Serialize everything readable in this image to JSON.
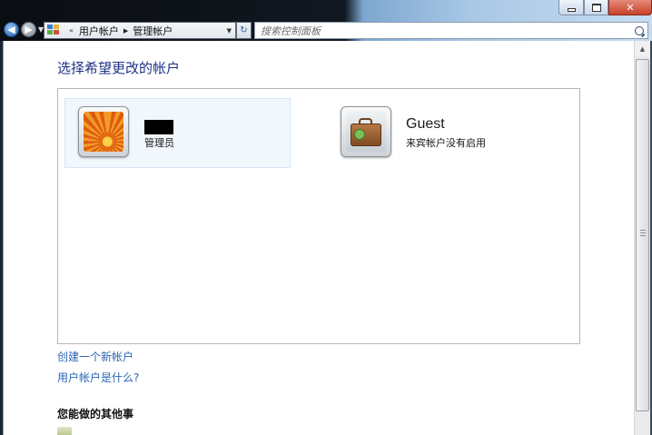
{
  "address_bar": {
    "overflow_marker": "«",
    "crumbs": [
      "用户帐户",
      "管理帐户"
    ]
  },
  "search": {
    "placeholder": "搜索控制面板"
  },
  "main": {
    "heading": "选择希望更改的帐户",
    "accounts": [
      {
        "name": "",
        "name_redacted": true,
        "role": "管理员",
        "selected": true,
        "picture": "orange-flower"
      },
      {
        "name": "Guest",
        "role": "来宾帐户没有启用",
        "selected": false,
        "picture": "briefcase"
      }
    ],
    "links": {
      "create_account": "创建一个新帐户",
      "what_is_account": "用户帐户是什么?"
    },
    "other_tasks": {
      "heading": "您能做的其他事"
    }
  },
  "colors": {
    "heading_blue": "#1e3287",
    "link_blue": "#2a64b4",
    "selected_bg": "#f1f7fd"
  }
}
